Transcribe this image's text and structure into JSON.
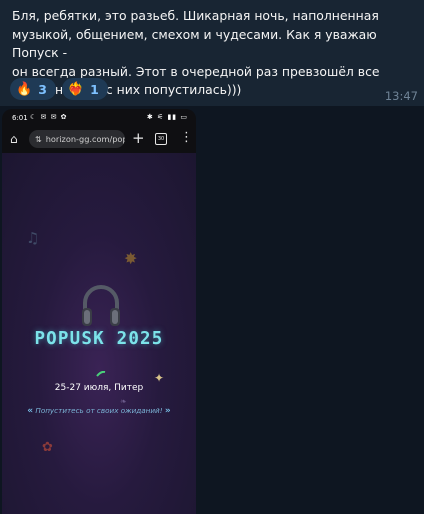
{
  "message": {
    "text": "Бля, ребятки, это разьеб. Шикарная ночь, наполненная\nмузыкой, общением, смехом и чудесами. Как я уважаю Попуск -\nон всегда разный. Этот в очередной раз превзошёл все\nожидания и я с них попустилась)))",
    "time": "13:47",
    "reactions": [
      {
        "emoji": "🔥",
        "count": "3",
        "icon": "fire-icon"
      },
      {
        "emoji": "❤️‍🔥",
        "count": "1",
        "icon": "heart-on-fire-icon"
      }
    ]
  },
  "phone": {
    "status": {
      "clock": "6:01"
    },
    "browser": {
      "url": "horizon-gg.com/pop"
    },
    "page": {
      "title": "POPUSK 2025",
      "dates": "25-27 июля, Питер",
      "tagline": "Попуститесь от своих ожиданий!",
      "quote_open": "«",
      "quote_close": "»"
    }
  },
  "colors": {
    "chat_bg": "#0e1621",
    "bubble_bg": "#182533",
    "reaction_bg": "#1f3a55",
    "reaction_count": "#7ec1ff",
    "title_cyan": "#7ce3ea"
  }
}
